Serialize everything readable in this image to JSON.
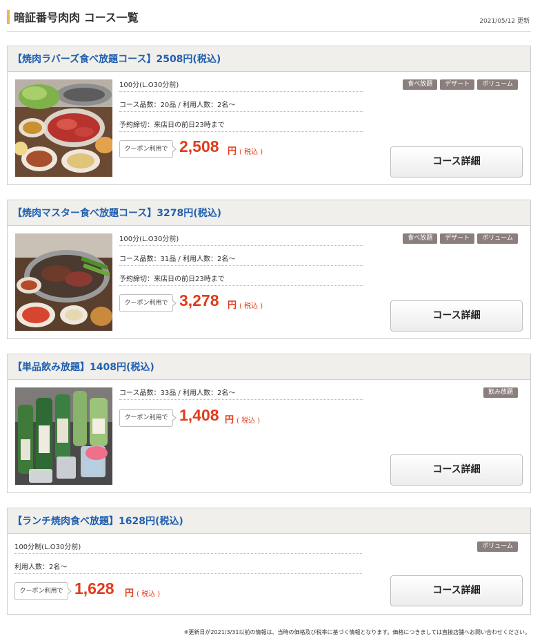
{
  "header": {
    "title": "暗証番号肉肉 コース一覧",
    "updated": "2021/05/12 更新"
  },
  "courses": [
    {
      "name": "【焼肉ラバーズ食べ放題コース】2508円(税込)",
      "details": [
        "100分(L.O30分前)",
        "コース品数：20品 / 利用人数：2名～",
        "予約締切：来店日の前日23時まで"
      ],
      "coupon_label": "クーポン利用で",
      "price": "2,508",
      "price_unit": "円",
      "price_tax": "( 税込 )",
      "tags": [
        "食べ放題",
        "デザート",
        "ボリューム"
      ],
      "button_label": "コース詳細"
    },
    {
      "name": "【焼肉マスター食べ放題コース】3278円(税込)",
      "details": [
        "100分(L.O30分前)",
        "コース品数：31品 / 利用人数：2名～",
        "予約締切：来店日の前日23時まで"
      ],
      "coupon_label": "クーポン利用で",
      "price": "3,278",
      "price_unit": "円",
      "price_tax": "( 税込 )",
      "tags": [
        "食べ放題",
        "デザート",
        "ボリューム"
      ],
      "button_label": "コース詳細"
    },
    {
      "name": "【単品飲み放題】1408円(税込)",
      "details": [
        "コース品数：33品 / 利用人数：2名～"
      ],
      "coupon_label": "クーポン利用で",
      "price": "1,408",
      "price_unit": "円",
      "price_tax": "( 税込 )",
      "tags": [
        "飲み放題"
      ],
      "button_label": "コース詳細"
    },
    {
      "name": "【ランチ焼肉食べ放題】1628円(税込)",
      "details": [
        "100分制(L.O30分前)",
        "利用人数：2名～"
      ],
      "coupon_label": "クーポン利用で",
      "price": "1,628",
      "price_unit": "円",
      "price_tax": "( 税込 )",
      "tags": [
        "ボリューム"
      ],
      "button_label": "コース詳細"
    }
  ],
  "footnote": "※更新日が2021/3/31以前の情報は、当時の価格及び税率に基づく情報となります。価格につきましては直接店舗へお問い合わせください。",
  "colors": {
    "accent_bar": "#f0b45a",
    "title_blue": "#2060b0",
    "price_red": "#e23c1b",
    "tag_bg": "#8a7f7d"
  }
}
